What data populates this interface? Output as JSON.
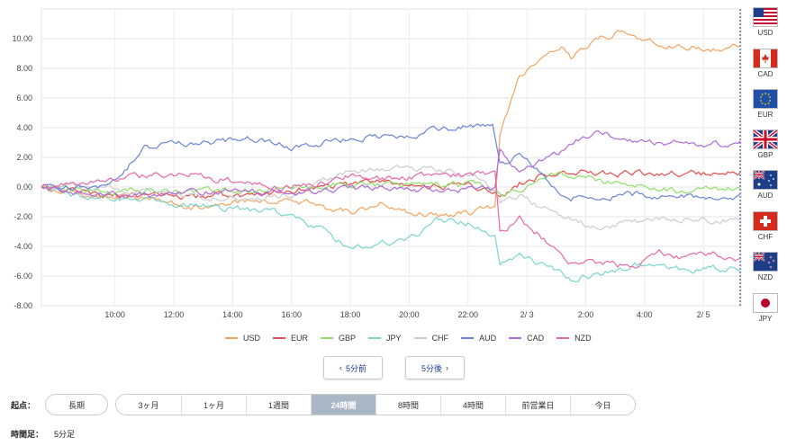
{
  "chart_data": {
    "type": "line",
    "y_ticks": [
      "10.00",
      "8.00",
      "6.00",
      "4.00",
      "2.00",
      "0.00",
      "-2.00",
      "-4.00",
      "-6.00",
      "-8.00"
    ],
    "ylim": [
      -8,
      12
    ],
    "x_ticks": [
      "10:00",
      "12:00",
      "14:00",
      "16:00",
      "18:00",
      "20:00",
      "22:00",
      "2/ 3",
      "2:00",
      "4:00",
      "2/ 5"
    ],
    "x_tick_index": [
      30,
      54,
      78,
      102,
      126,
      150,
      174,
      198,
      222,
      246,
      270
    ],
    "n_points": 285,
    "series": [
      {
        "name": "USD",
        "color": "#f4a460",
        "keys": [
          [
            0,
            0
          ],
          [
            12,
            -0.3
          ],
          [
            24,
            -0.6
          ],
          [
            36,
            -0.8
          ],
          [
            48,
            -0.9
          ],
          [
            60,
            -1.4
          ],
          [
            72,
            -1.2
          ],
          [
            84,
            -1.0
          ],
          [
            96,
            -0.8
          ],
          [
            108,
            -1.0
          ],
          [
            114,
            -1.4
          ],
          [
            126,
            -1.6
          ],
          [
            138,
            -1.2
          ],
          [
            150,
            -1.7
          ],
          [
            162,
            -2.0
          ],
          [
            174,
            -1.7
          ],
          [
            185,
            -1.4
          ],
          [
            187,
            3.5
          ],
          [
            195,
            7.5
          ],
          [
            204,
            8.7
          ],
          [
            212,
            9.3
          ],
          [
            216,
            8.6
          ],
          [
            225,
            9.8
          ],
          [
            235,
            10.4
          ],
          [
            243,
            10.1
          ],
          [
            252,
            9.6
          ],
          [
            262,
            9.4
          ],
          [
            274,
            9.3
          ],
          [
            285,
            9.6
          ]
        ]
      },
      {
        "name": "EUR",
        "color": "#e84b4b",
        "keys": [
          [
            0,
            0
          ],
          [
            12,
            -0.2
          ],
          [
            24,
            -0.5
          ],
          [
            36,
            -0.6
          ],
          [
            48,
            -0.6
          ],
          [
            60,
            -0.7
          ],
          [
            72,
            -0.6
          ],
          [
            84,
            -0.5
          ],
          [
            96,
            -0.3
          ],
          [
            108,
            -0.1
          ],
          [
            114,
            0.2
          ],
          [
            126,
            0.1
          ],
          [
            138,
            0.3
          ],
          [
            150,
            0.2
          ],
          [
            162,
            0.1
          ],
          [
            174,
            0.1
          ],
          [
            185,
            -0.2
          ],
          [
            187,
            -0.8
          ],
          [
            195,
            0.2
          ],
          [
            204,
            0.8
          ],
          [
            212,
            1.1
          ],
          [
            216,
            1.0
          ],
          [
            225,
            1.0
          ],
          [
            235,
            0.9
          ],
          [
            243,
            1.0
          ],
          [
            252,
            0.9
          ],
          [
            262,
            0.9
          ],
          [
            274,
            0.9
          ],
          [
            285,
            0.9
          ]
        ]
      },
      {
        "name": "GBP",
        "color": "#8ce06a",
        "keys": [
          [
            0,
            0
          ],
          [
            12,
            -0.2
          ],
          [
            24,
            -0.3
          ],
          [
            36,
            -0.2
          ],
          [
            48,
            -0.3
          ],
          [
            60,
            -0.4
          ],
          [
            72,
            -0.3
          ],
          [
            84,
            -0.3
          ],
          [
            96,
            -0.1
          ],
          [
            108,
            0.0
          ],
          [
            114,
            0.1
          ],
          [
            126,
            0.2
          ],
          [
            138,
            0.1
          ],
          [
            150,
            0.2
          ],
          [
            162,
            0.1
          ],
          [
            174,
            0.2
          ],
          [
            185,
            0.0
          ],
          [
            187,
            -0.6
          ],
          [
            195,
            -0.2
          ],
          [
            204,
            0.5
          ],
          [
            212,
            1.0
          ],
          [
            216,
            0.6
          ],
          [
            225,
            0.5
          ],
          [
            235,
            0.2
          ],
          [
            243,
            0.0
          ],
          [
            252,
            -0.2
          ],
          [
            262,
            -0.3
          ],
          [
            274,
            -0.1
          ],
          [
            285,
            -0.1
          ]
        ]
      },
      {
        "name": "JPY",
        "color": "#7ad6cd",
        "keys": [
          [
            0,
            0
          ],
          [
            12,
            -0.5
          ],
          [
            24,
            -0.8
          ],
          [
            36,
            -0.8
          ],
          [
            48,
            -1.0
          ],
          [
            60,
            -1.2
          ],
          [
            72,
            -1.4
          ],
          [
            84,
            -1.5
          ],
          [
            96,
            -1.7
          ],
          [
            102,
            -2.0
          ],
          [
            114,
            -2.8
          ],
          [
            126,
            -4.2
          ],
          [
            138,
            -3.7
          ],
          [
            150,
            -3.6
          ],
          [
            162,
            -2.2
          ],
          [
            174,
            -2.4
          ],
          [
            185,
            -3.5
          ],
          [
            187,
            -5.4
          ],
          [
            195,
            -4.5
          ],
          [
            204,
            -5.2
          ],
          [
            212,
            -5.8
          ],
          [
            216,
            -6.2
          ],
          [
            225,
            -6.0
          ],
          [
            235,
            -5.6
          ],
          [
            243,
            -5.3
          ],
          [
            252,
            -5.2
          ],
          [
            262,
            -5.6
          ],
          [
            274,
            -5.5
          ],
          [
            285,
            -5.5
          ]
        ]
      },
      {
        "name": "CHF",
        "color": "#cccccc",
        "keys": [
          [
            0,
            0
          ],
          [
            12,
            0.2
          ],
          [
            24,
            0.0
          ],
          [
            36,
            -0.2
          ],
          [
            48,
            -0.4
          ],
          [
            60,
            -0.6
          ],
          [
            72,
            -0.7
          ],
          [
            84,
            -0.8
          ],
          [
            96,
            -0.6
          ],
          [
            108,
            -0.4
          ],
          [
            114,
            0.5
          ],
          [
            126,
            1.0
          ],
          [
            138,
            1.2
          ],
          [
            150,
            1.3
          ],
          [
            162,
            1.1
          ],
          [
            174,
            0.8
          ],
          [
            185,
            0.0
          ],
          [
            187,
            -1.0
          ],
          [
            195,
            -0.6
          ],
          [
            204,
            -1.4
          ],
          [
            212,
            -1.8
          ],
          [
            216,
            -2.2
          ],
          [
            225,
            -2.7
          ],
          [
            235,
            -2.5
          ],
          [
            243,
            -2.3
          ],
          [
            252,
            -2.2
          ],
          [
            262,
            -2.1
          ],
          [
            274,
            -2.2
          ],
          [
            285,
            -2.2
          ]
        ]
      },
      {
        "name": "AUD",
        "color": "#6b84d8",
        "keys": [
          [
            0,
            0
          ],
          [
            12,
            0.0
          ],
          [
            24,
            0.1
          ],
          [
            30,
            0.5
          ],
          [
            36,
            1.5
          ],
          [
            42,
            2.6
          ],
          [
            48,
            2.8
          ],
          [
            60,
            3.0
          ],
          [
            72,
            3.0
          ],
          [
            84,
            3.2
          ],
          [
            96,
            3.0
          ],
          [
            102,
            2.6
          ],
          [
            114,
            2.9
          ],
          [
            126,
            3.3
          ],
          [
            138,
            3.5
          ],
          [
            150,
            3.4
          ],
          [
            162,
            3.9
          ],
          [
            174,
            4.1
          ],
          [
            184,
            4.3
          ],
          [
            187,
            1.5
          ],
          [
            195,
            2.2
          ],
          [
            204,
            1.0
          ],
          [
            212,
            -0.4
          ],
          [
            216,
            -0.7
          ],
          [
            225,
            -0.8
          ],
          [
            235,
            -0.6
          ],
          [
            243,
            -0.5
          ],
          [
            252,
            -0.6
          ],
          [
            262,
            -0.7
          ],
          [
            274,
            -0.7
          ],
          [
            285,
            -0.7
          ]
        ]
      },
      {
        "name": "CAD",
        "color": "#b06ad8",
        "keys": [
          [
            0,
            0
          ],
          [
            12,
            -0.3
          ],
          [
            24,
            -0.4
          ],
          [
            36,
            -0.5
          ],
          [
            48,
            -0.6
          ],
          [
            60,
            -0.4
          ],
          [
            72,
            -0.3
          ],
          [
            84,
            -0.3
          ],
          [
            96,
            -0.3
          ],
          [
            108,
            -0.2
          ],
          [
            114,
            -0.2
          ],
          [
            126,
            -0.1
          ],
          [
            138,
            0.0
          ],
          [
            150,
            -0.1
          ],
          [
            162,
            -0.3
          ],
          [
            174,
            -0.2
          ],
          [
            185,
            -0.2
          ],
          [
            187,
            2.6
          ],
          [
            195,
            1.0
          ],
          [
            204,
            1.7
          ],
          [
            212,
            2.4
          ],
          [
            216,
            3.0
          ],
          [
            225,
            3.7
          ],
          [
            235,
            3.4
          ],
          [
            243,
            3.0
          ],
          [
            252,
            2.9
          ],
          [
            262,
            3.0
          ],
          [
            274,
            2.9
          ],
          [
            285,
            3.0
          ]
        ]
      },
      {
        "name": "NZD",
        "color": "#e868a8",
        "keys": [
          [
            0,
            0
          ],
          [
            12,
            0.2
          ],
          [
            24,
            0.6
          ],
          [
            36,
            0.7
          ],
          [
            48,
            0.8
          ],
          [
            60,
            0.9
          ],
          [
            72,
            0.5
          ],
          [
            84,
            0.4
          ],
          [
            96,
            0.0
          ],
          [
            108,
            0.1
          ],
          [
            114,
            0.3
          ],
          [
            126,
            0.8
          ],
          [
            138,
            0.6
          ],
          [
            150,
            0.7
          ],
          [
            162,
            0.8
          ],
          [
            174,
            0.9
          ],
          [
            185,
            1.0
          ],
          [
            187,
            -3.2
          ],
          [
            195,
            -2.0
          ],
          [
            204,
            -3.4
          ],
          [
            212,
            -4.6
          ],
          [
            216,
            -5.0
          ],
          [
            225,
            -5.0
          ],
          [
            235,
            -5.3
          ],
          [
            243,
            -5.2
          ],
          [
            252,
            -4.5
          ],
          [
            262,
            -4.8
          ],
          [
            274,
            -4.4
          ],
          [
            285,
            -5.0
          ]
        ]
      }
    ]
  },
  "flags": [
    {
      "code": "USD"
    },
    {
      "code": "CAD"
    },
    {
      "code": "EUR"
    },
    {
      "code": "GBP"
    },
    {
      "code": "AUD"
    },
    {
      "code": "CHF"
    },
    {
      "code": "NZD"
    },
    {
      "code": "JPY"
    }
  ],
  "nav": {
    "prev_label": "5分前",
    "next_label": "5分後",
    "prev_icon": "‹",
    "next_icon": "›"
  },
  "start_point": {
    "label": "起点：",
    "long_term_label": "長期",
    "options": [
      "3ヶ月",
      "1ヶ月",
      "1週間",
      "24時間",
      "8時間",
      "4時間",
      "前営業日",
      "今日"
    ],
    "active": "24時間"
  },
  "timeframe": {
    "label": "時間足：",
    "value": "5分足"
  }
}
